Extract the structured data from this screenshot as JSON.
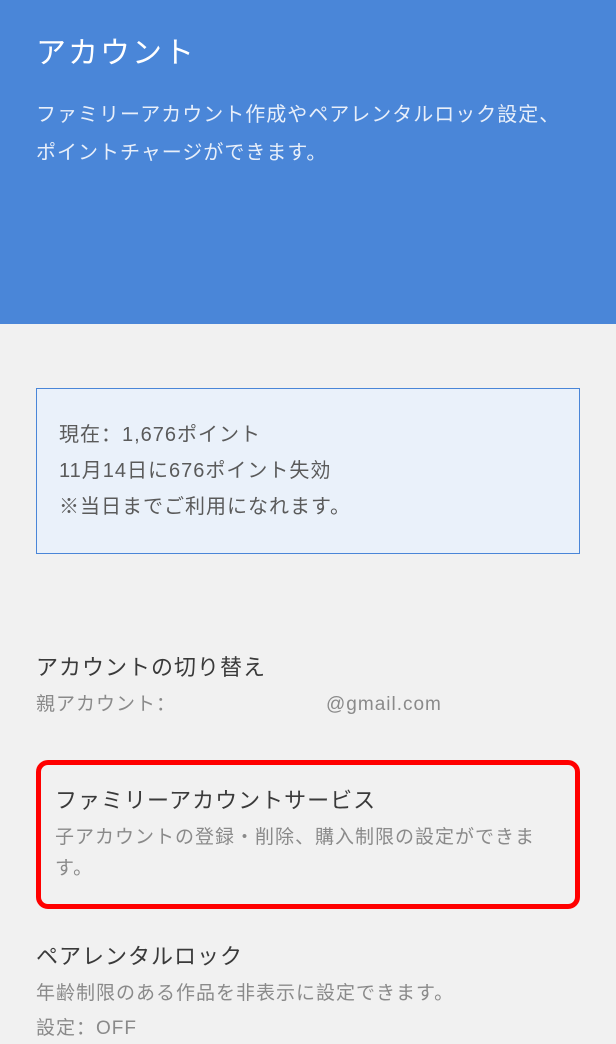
{
  "header": {
    "title": "アカウント",
    "desc_line1": "ファミリーアカウント作成やペアレンタルロック設定、",
    "desc_line2": "ポイントチャージができます。"
  },
  "points": {
    "line1": "現在：1,676ポイント",
    "line2": "11月14日に676ポイント失効",
    "line3": "※当日までご利用になれます。"
  },
  "switch": {
    "title": "アカウントの切り替え",
    "parent_label": "親アカウント：",
    "email": "@gmail.com"
  },
  "family": {
    "title": "ファミリーアカウントサービス",
    "desc": "子アカウントの登録・削除、購入制限の設定ができます。"
  },
  "parental": {
    "title": "ペアレンタルロック",
    "desc": "年齢制限のある作品を非表示に設定できます。",
    "status": "設定：OFF"
  }
}
